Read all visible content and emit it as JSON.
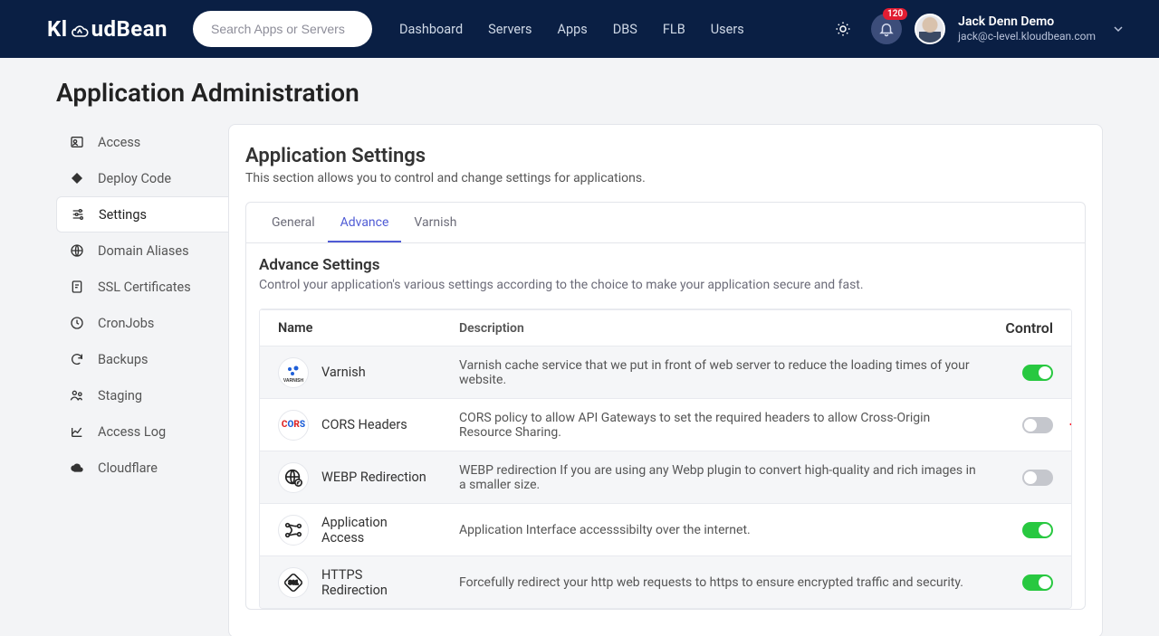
{
  "brand": "KloudBean",
  "search": {
    "placeholder": "Search Apps or Servers"
  },
  "nav": [
    "Dashboard",
    "Servers",
    "Apps",
    "DBS",
    "FLB",
    "Users"
  ],
  "notifications": {
    "count": "120"
  },
  "user": {
    "name": "Jack Denn Demo",
    "email": "jack@c-level.kloudbean.com"
  },
  "page_title": "Application Administration",
  "sidebar": [
    {
      "label": "Access",
      "icon": "user-card-icon"
    },
    {
      "label": "Deploy Code",
      "icon": "diamond-icon"
    },
    {
      "label": "Settings",
      "icon": "sliders-icon",
      "active": true
    },
    {
      "label": "Domain Aliases",
      "icon": "globe-icon"
    },
    {
      "label": "SSL Certificates",
      "icon": "certificate-icon"
    },
    {
      "label": "CronJobs",
      "icon": "clock-icon"
    },
    {
      "label": "Backups",
      "icon": "refresh-icon"
    },
    {
      "label": "Staging",
      "icon": "people-icon"
    },
    {
      "label": "Access Log",
      "icon": "chart-icon"
    },
    {
      "label": "Cloudflare",
      "icon": "cloud-icon"
    }
  ],
  "card": {
    "title": "Application Settings",
    "subtitle": "This section allows you to control and change settings for applications.",
    "tabs": [
      "General",
      "Advance",
      "Varnish"
    ],
    "active_tab": 1,
    "section_title": "Advance Settings",
    "section_desc": "Control your application's various settings according to the choice to make your application secure and fast.",
    "columns": {
      "name": "Name",
      "desc": "Description",
      "ctrl": "Control"
    },
    "rows": [
      {
        "name": "Varnish",
        "desc": "Varnish cache service that we put in front of web server to reduce the loading times of your website.",
        "on": true
      },
      {
        "name": "CORS Headers",
        "desc": "CORS policy to allow API Gateways to set the required headers to allow Cross-Origin Resource Sharing.",
        "on": false,
        "callout": true
      },
      {
        "name": "WEBP Redirection",
        "desc": "WEBP redirection If you are using any Webp plugin to convert high-quality and rich images in a smaller size.",
        "on": false
      },
      {
        "name": "Application Access",
        "desc": "Application Interface accesssibilty over the internet.",
        "on": true
      },
      {
        "name": "HTTPS Redirection",
        "desc": "Forcefully redirect your http web requests to https to ensure encrypted traffic and security.",
        "on": true
      }
    ]
  },
  "colors": {
    "accent": "#4f5bd5",
    "toggle_on": "#28c840",
    "badge": "#e11d32",
    "header_bg": "#0a1f44"
  }
}
